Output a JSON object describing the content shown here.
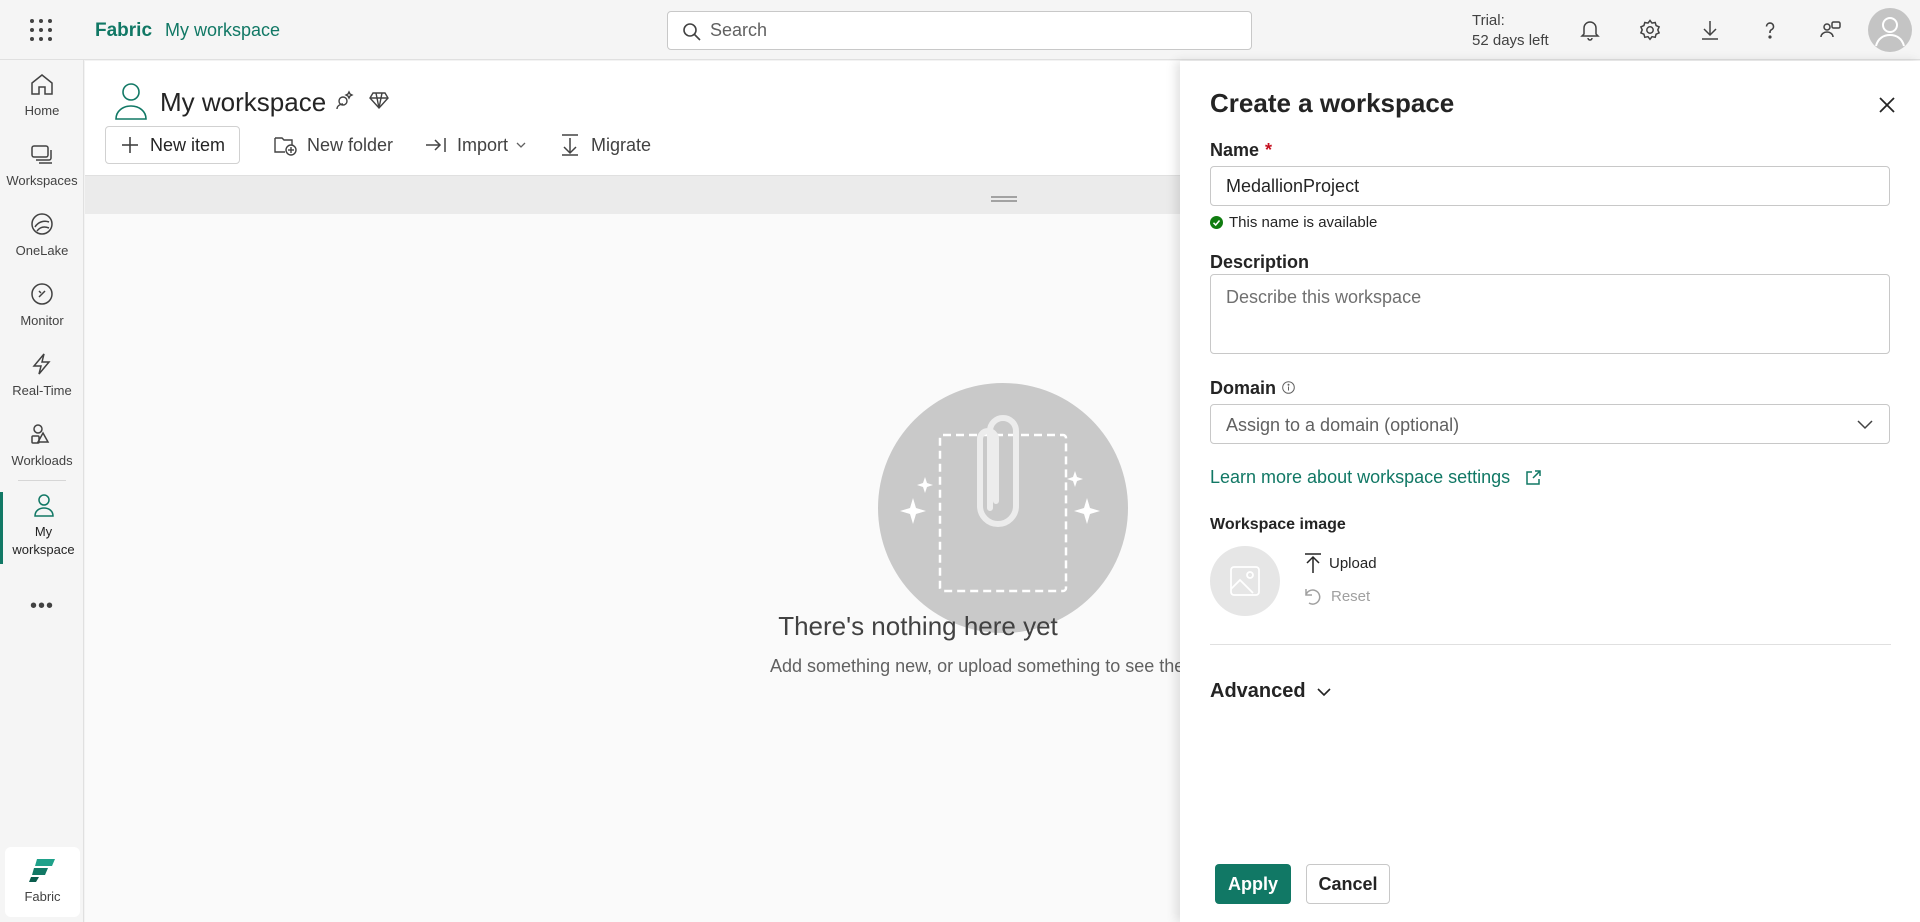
{
  "topbar": {
    "brand": "Fabric",
    "breadcrumb": "My workspace",
    "search_placeholder": "Search",
    "trial_line1": "Trial:",
    "trial_line2": "52 days left"
  },
  "nav": {
    "items": [
      {
        "label": "Home",
        "icon": "home-icon"
      },
      {
        "label": "Workspaces",
        "icon": "workspaces-icon"
      },
      {
        "label": "OneLake",
        "icon": "onelake-icon"
      },
      {
        "label": "Monitor",
        "icon": "monitor-icon"
      },
      {
        "label": "Real-Time",
        "icon": "lightning-icon"
      },
      {
        "label": "Workloads",
        "icon": "workloads-icon"
      },
      {
        "label": "My workspace",
        "icon": "person-icon"
      }
    ],
    "more": "•••",
    "footer_label": "Fabric"
  },
  "main": {
    "title": "My workspace",
    "toolbar": {
      "new_item": "New item",
      "new_folder": "New folder",
      "import": "Import",
      "migrate": "Migrate"
    },
    "empty_title": "There's nothing here yet",
    "empty_subtitle": "Add something new, or upload something to see ther"
  },
  "panel": {
    "title": "Create a workspace",
    "name_label": "Name",
    "required_mark": "*",
    "name_value": "MedallionProject",
    "availability": "This name is available",
    "description_label": "Description",
    "description_placeholder": "Describe this workspace",
    "domain_label": "Domain",
    "domain_placeholder": "Assign to a domain (optional)",
    "learn_more": "Learn more about workspace settings",
    "image_label": "Workspace image",
    "upload": "Upload",
    "reset": "Reset",
    "advanced": "Advanced",
    "apply": "Apply",
    "cancel": "Cancel"
  },
  "colors": {
    "accent": "#117865",
    "success": "#107c10",
    "required": "#c50f1f"
  }
}
